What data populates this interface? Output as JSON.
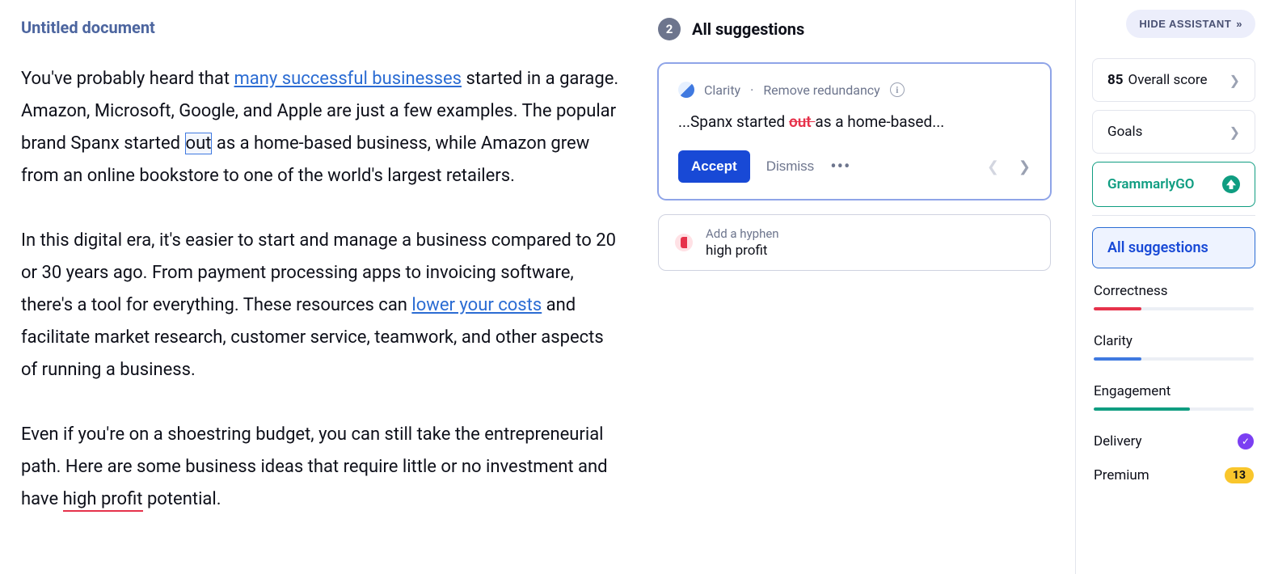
{
  "doc": {
    "title": "Untitled document",
    "p1_a": "You've probably heard that ",
    "p1_link1": "many successful businesses",
    "p1_b": " started in a garage. Amazon, Microsoft, Google, and Apple are just a few examples. The popular brand Spanx started ",
    "p1_hl": "out",
    "p1_c": " as a home-based business, while Amazon grew from an online bookstore to one of the world's largest retailers.",
    "p2_a": "In this digital era, it's easier to start and manage a business compared to 20 or 30 years ago. From payment processing apps to invoicing software, there's a tool for everything. These resources can ",
    "p2_link": "lower your costs",
    "p2_b": " and facilitate market research, customer service, teamwork, and other aspects of running a business.",
    "p3_a": "Even if you're on a shoestring budget, you can still take the entrepreneurial path. Here are some business ideas that require little or no investment and have ",
    "p3_hl": "high profit",
    "p3_b": " potential."
  },
  "suggestions": {
    "count": "2",
    "heading": "All suggestions",
    "card1": {
      "category": "Clarity",
      "rule": "Remove redundancy",
      "preview_before": "...Spanx started ",
      "preview_strike": "out ",
      "preview_after": "as a home-based...",
      "accept": "Accept",
      "dismiss": "Dismiss"
    },
    "card2": {
      "rule": "Add a hyphen",
      "text": "high profit"
    }
  },
  "sidebar": {
    "hide": "HIDE ASSISTANT",
    "score_val": "85",
    "score_label": "Overall score",
    "goals": "Goals",
    "go": "GrammarlyGO",
    "all_suggestions": "All suggestions",
    "correctness": "Correctness",
    "clarity": "Clarity",
    "engagement": "Engagement",
    "delivery": "Delivery",
    "premium": "Premium",
    "premium_count": "13"
  }
}
